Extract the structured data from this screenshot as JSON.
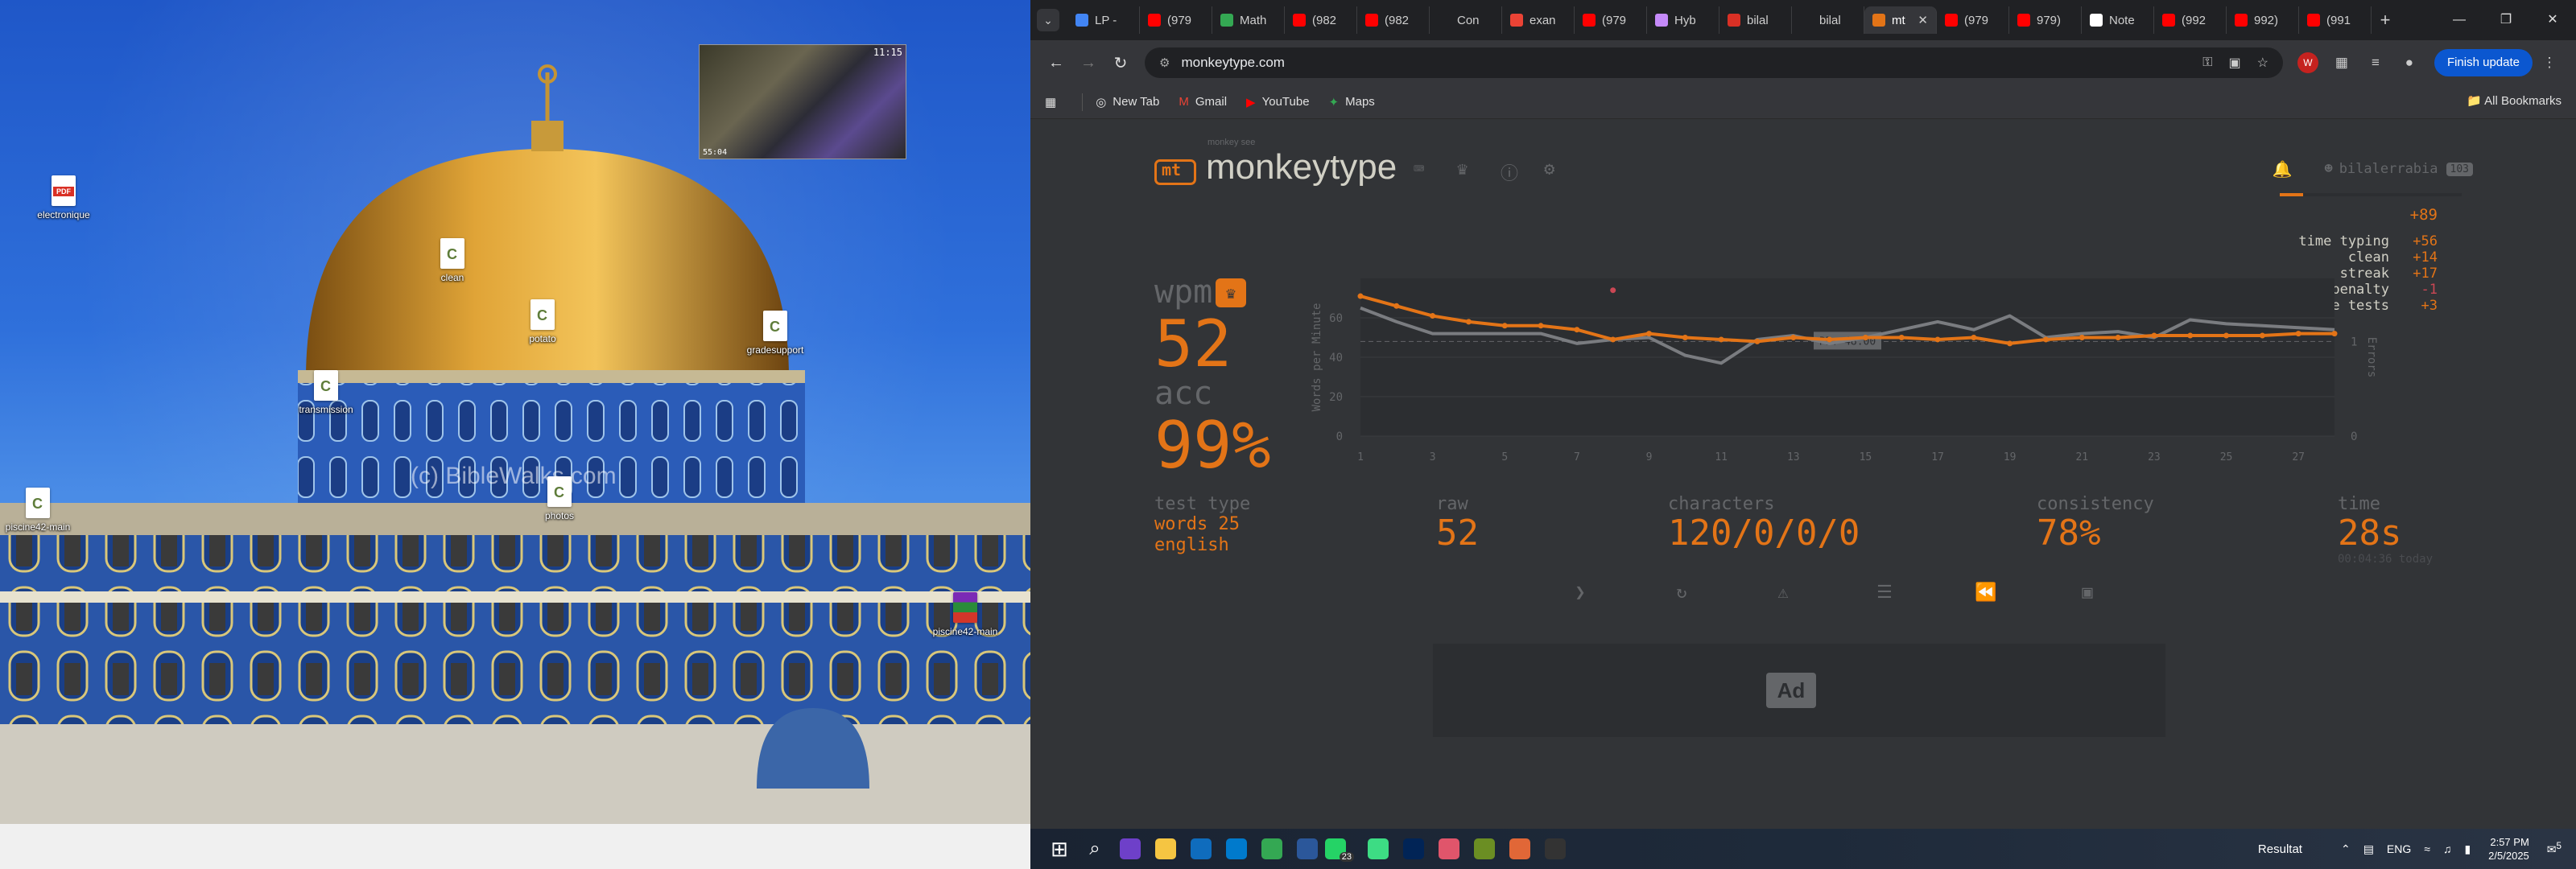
{
  "desktop": {
    "icons": [
      {
        "label": "electronique",
        "type": "pdf"
      },
      {
        "label": "clean",
        "type": "c"
      },
      {
        "label": "potato",
        "type": "c"
      },
      {
        "label": "gradesupport",
        "type": "c"
      },
      {
        "label": "transmission",
        "type": "c"
      },
      {
        "label": "piscine42-main",
        "type": "c"
      },
      {
        "label": "photos",
        "type": "c"
      },
      {
        "label": "piscine42-main",
        "type": "zip"
      }
    ],
    "video": {
      "time": "11:15",
      "sub": "55:04"
    },
    "watermark": "(c) BibleWalks.com"
  },
  "browser": {
    "tabs": [
      {
        "label": "LP -",
        "color": "#4285f4"
      },
      {
        "label": "(979",
        "color": "#ff0000"
      },
      {
        "label": "Math",
        "color": "#34a853"
      },
      {
        "label": "(982",
        "color": "#ff0000"
      },
      {
        "label": "(982",
        "color": "#ff0000"
      },
      {
        "label": "Con",
        "color": "#202124"
      },
      {
        "label": "exan",
        "color": "#ea4335"
      },
      {
        "label": "(979",
        "color": "#ff0000"
      },
      {
        "label": "Hyb",
        "color": "#c58af9"
      },
      {
        "label": "bilal",
        "color": "#d93025"
      },
      {
        "label": "bilal",
        "color": "#202124"
      },
      {
        "label": "mt",
        "color": "#e37417",
        "active": true
      },
      {
        "label": "(979",
        "color": "#ff0000"
      },
      {
        "label": "979)",
        "color": "#ff0000"
      },
      {
        "label": "Note",
        "color": "#ffffff"
      },
      {
        "label": "(992",
        "color": "#ff0000"
      },
      {
        "label": "992)",
        "color": "#ff0000"
      },
      {
        "label": "(991",
        "color": "#ff0000"
      }
    ],
    "url": "monkeytype.com",
    "finish_update": "Finish update",
    "bookmarks": [
      {
        "label": "New Tab",
        "icon": "◎"
      },
      {
        "label": "Gmail",
        "icon": "M"
      },
      {
        "label": "YouTube",
        "icon": "▶"
      },
      {
        "label": "Maps",
        "icon": "✦"
      }
    ],
    "all_bookmarks": "All Bookmarks"
  },
  "monkeytype": {
    "logo_top": "monkey see",
    "logo": "monkeytype",
    "username": "bilalerrabia",
    "level": "103",
    "xp_progress": 0.13,
    "xp_total": "+89",
    "xp_rows": [
      {
        "k": "time typing",
        "v": "+56"
      },
      {
        "k": "clean",
        "v": "+14"
      },
      {
        "k": "streak",
        "v": "+17"
      },
      {
        "k": "accuracy penalty",
        "v": "-1",
        "neg": true
      },
      {
        "k": "incomplete tests",
        "v": "+3"
      }
    ],
    "wpm_label": "wpm",
    "wpm": "52",
    "acc_label": "acc",
    "acc": "99%",
    "test_type_label": "test type",
    "test_type_1": "words 25",
    "test_type_2": "english",
    "raw_label": "raw",
    "raw": "52",
    "characters_label": "characters",
    "characters": "120/0/0/0",
    "consistency_label": "consistency",
    "consistency": "78%",
    "time_label": "time",
    "time": "28s",
    "time_today": "00:04:36 today",
    "ad": "Ad"
  },
  "chart_data": {
    "type": "line",
    "ylabel": "Words per Minute",
    "y2label": "Errors",
    "ylim": [
      0,
      80
    ],
    "y_ticks": [
      0,
      20,
      40,
      60
    ],
    "y2_ticks": [
      0,
      1
    ],
    "x_ticks": [
      1,
      3,
      5,
      7,
      9,
      11,
      13,
      15,
      17,
      19,
      21,
      23,
      25,
      27
    ],
    "pb_label": "PB: 48.00",
    "pb_value": 48,
    "x": [
      1,
      2,
      3,
      4,
      5,
      6,
      7,
      8,
      9,
      10,
      11,
      12,
      13,
      14,
      15,
      16,
      17,
      18,
      19,
      20,
      21,
      22,
      23,
      24,
      25,
      26,
      27,
      28
    ],
    "series": [
      {
        "name": "wpm",
        "color": "#e37417",
        "values": [
          71,
          66,
          61,
          58,
          56,
          56,
          54,
          49,
          52,
          50,
          49,
          48,
          50,
          49,
          50,
          50,
          49,
          50,
          47,
          49,
          50,
          50,
          51,
          51,
          51,
          51,
          52,
          52
        ]
      },
      {
        "name": "raw",
        "color": "#7a7c80",
        "values": [
          65,
          58,
          52,
          52,
          52,
          52,
          47,
          49,
          50,
          41,
          37,
          49,
          51,
          47,
          50,
          54,
          58,
          54,
          61,
          50,
          52,
          53,
          50,
          59,
          57,
          56,
          55,
          54
        ]
      }
    ],
    "errors": [
      {
        "x": 8,
        "value": 1
      }
    ]
  },
  "taskbar": {
    "apps": [
      {
        "name": "start",
        "color": "#ffffff"
      },
      {
        "name": "search",
        "color": "#ffffff"
      },
      {
        "name": "github",
        "color": "#6e40c9"
      },
      {
        "name": "explorer",
        "color": "#f5c542"
      },
      {
        "name": "outlook",
        "color": "#0f6cbd"
      },
      {
        "name": "vscode",
        "color": "#007acc"
      },
      {
        "name": "chrome",
        "color": "#34a853"
      },
      {
        "name": "word",
        "color": "#2b579a"
      },
      {
        "name": "whatsapp",
        "color": "#25d366"
      },
      {
        "name": "refresh",
        "color": "#3ddc84"
      },
      {
        "name": "powershell",
        "color": "#012456"
      },
      {
        "name": "paint",
        "color": "#e0556b"
      },
      {
        "name": "minecraft",
        "color": "#6b8e23"
      },
      {
        "name": "matlab",
        "color": "#e16737"
      },
      {
        "name": "media",
        "color": "#333333"
      }
    ],
    "whatsapp_badge": "23",
    "resultat": "Resultat",
    "lang": "ENG",
    "time": "2:57 PM",
    "date": "2/5/2025",
    "notif": "5"
  }
}
